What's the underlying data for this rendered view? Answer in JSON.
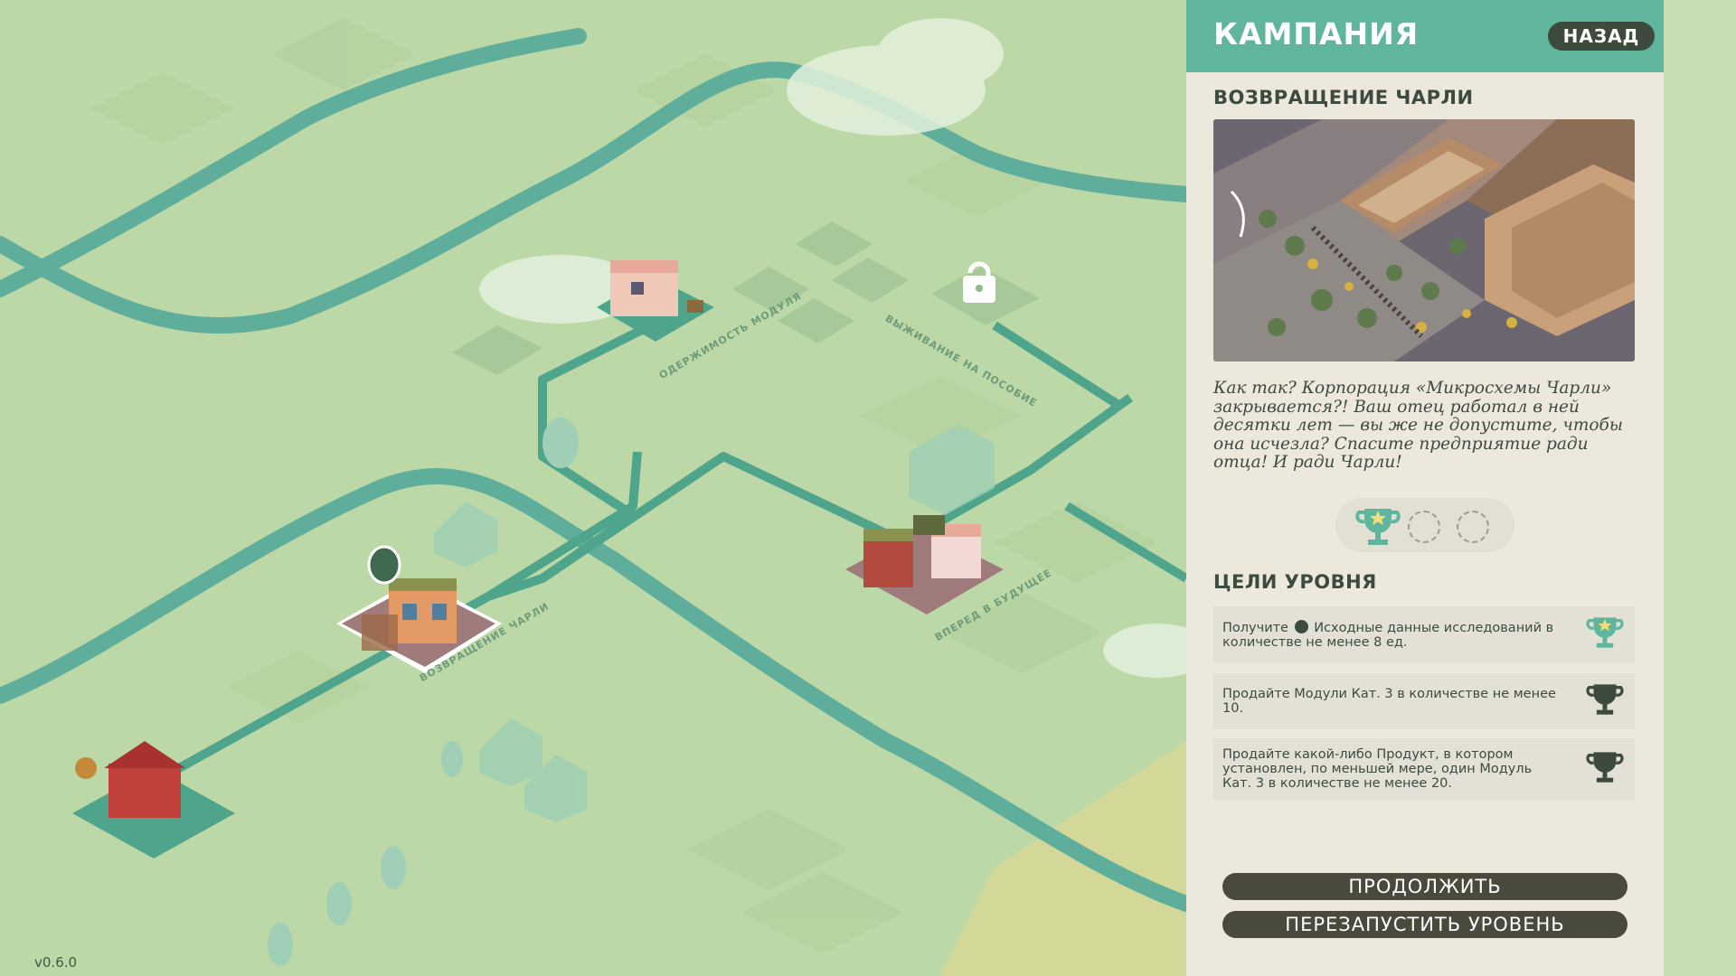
{
  "version": "v0.6.0",
  "map": {
    "levels": [
      {
        "label": "ОДЕРЖИМОСТЬ МОДУЛЯ"
      },
      {
        "label": "ВЫЖИВАНИЕ НА ПОСОБИЕ"
      },
      {
        "label": "ВОЗВРАЩЕНИЕ ЧАРЛИ"
      },
      {
        "label": "ВПЕРЕД В БУДУЩЕЕ"
      }
    ]
  },
  "panel": {
    "title": "КАМПАНИЯ",
    "back_label": "НАЗАД",
    "level_title": "ВОЗВРАЩЕНИЕ ЧАРЛИ",
    "description": "Как так? Корпорация «Микросхемы Чарли» закрывается?! Ваш отец работал в ней десятки лет — вы же не допустите, чтобы она исчезла? Спасите предприятие ради отца! И ради Чарли!",
    "trophies_earned": 1,
    "trophies_total": 3,
    "goals_heading": "ЦЕЛИ УРОВНЯ",
    "goals": [
      {
        "prefix": "Получите",
        "text": "Исходные данные исследований в количестве не менее 8 ед.",
        "status": "completed",
        "icon": "trophy-star-icon"
      },
      {
        "prefix": "",
        "text": "Продайте Модули Кат. 3 в количестве не менее 10.",
        "status": "incomplete",
        "icon": "trophy-icon"
      },
      {
        "prefix": "",
        "text": "Продайте какой-либо Продукт, в котором установлен, по меньшей мере, один Модуль Кат. 3 в количестве не менее 20.",
        "status": "incomplete",
        "icon": "trophy-icon"
      }
    ],
    "continue_label": "ПРОДОЛЖИТЬ",
    "restart_label": "ПЕРЕЗАПУСТИТЬ УРОВЕНЬ"
  },
  "colors": {
    "accent": "#5fb69c",
    "river": "#5fae9c",
    "map_bg": "#bcd8a6",
    "panel_bg": "#ece8dc",
    "button_dark": "#4a4a3c",
    "trophy_teal": "#5fb69c",
    "trophy_dark": "#3d4a3e"
  }
}
